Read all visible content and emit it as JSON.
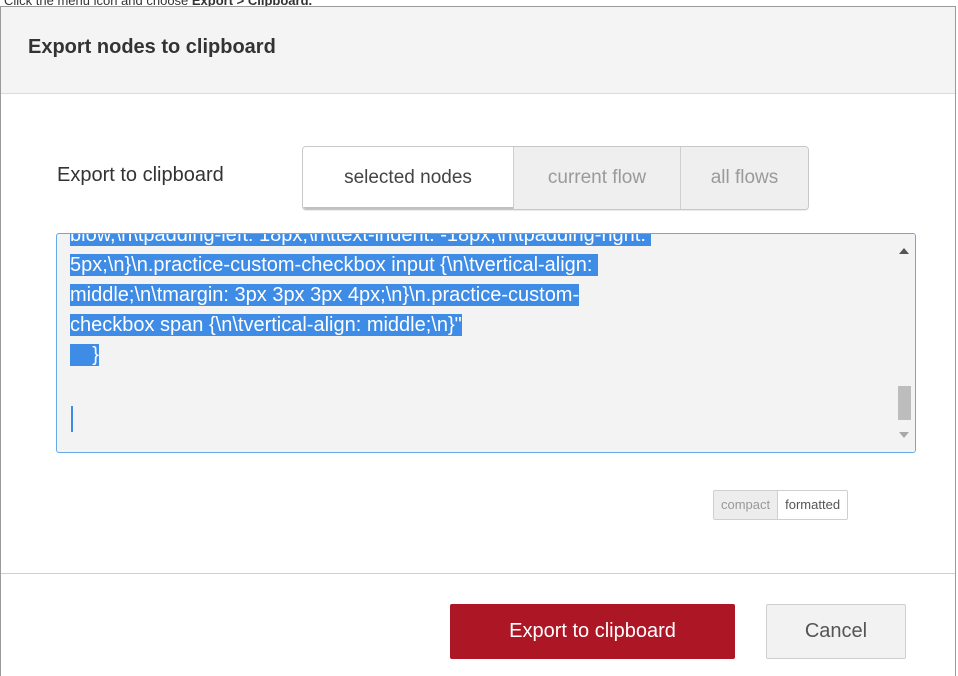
{
  "instruction": {
    "prefix": "Click the menu icon and choose ",
    "bold": "Export > Clipboard."
  },
  "dialog": {
    "title": "Export nodes to clipboard",
    "export_label": "Export to clipboard",
    "scope_tabs": [
      {
        "label": "selected nodes",
        "active": true
      },
      {
        "label": "current flow",
        "active": false
      },
      {
        "label": "all flows",
        "active": false
      }
    ],
    "code_lines": [
      "blow,\\n\\tpadding-left: 18px;\\n\\ttext-indent: -18px;\\n\\tpadding-right: ",
      "5px;\\n}\\n.practice-custom-checkbox input {\\n\\tvertical-align: ",
      "middle;\\n\\tmargin: 3px 3px 3px 4px;\\n}\\n.practice-custom-",
      "checkbox span {\\n\\tvertical-align: middle;\\n}\"",
      "    }"
    ],
    "format_tabs": [
      {
        "label": "compact",
        "active": false
      },
      {
        "label": "formatted",
        "active": true
      }
    ],
    "primary_button": "Export to clipboard",
    "cancel_button": "Cancel"
  },
  "colors": {
    "primary": "#ad1625",
    "selection": "#3e8ce6",
    "focus_border": "#66a9e8"
  },
  "icons": {
    "scroll_up": "triangle-up",
    "scroll_down": "triangle-down"
  }
}
